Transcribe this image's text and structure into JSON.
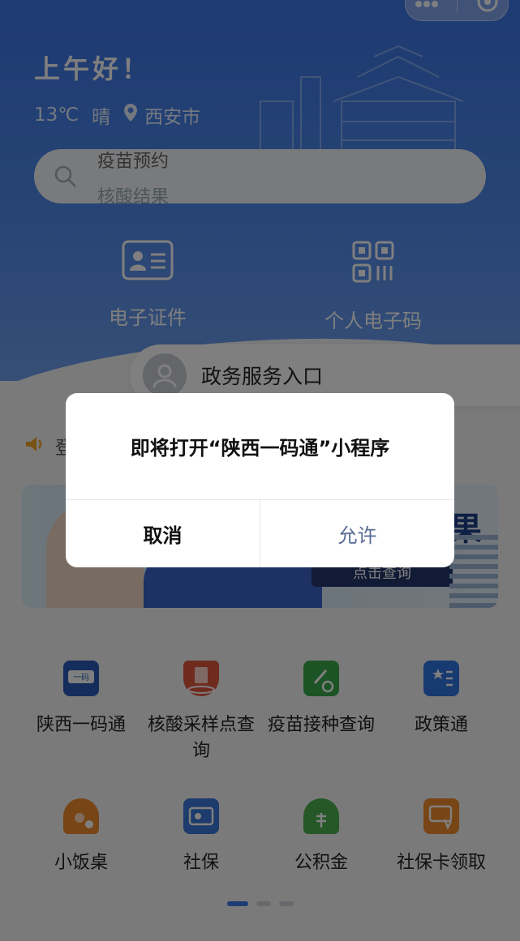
{
  "header": {
    "greeting": "上午好！",
    "temperature": "13℃",
    "weather": "晴",
    "city": "西安市",
    "search_rotating": [
      "疫苗预约",
      "核酸结果"
    ]
  },
  "quick_actions": [
    {
      "label": "电子证件",
      "icon": "id-card-icon"
    },
    {
      "label": "个人电子码",
      "icon": "qr-code-icon"
    }
  ],
  "gov_entry": {
    "label": "政务服务入口"
  },
  "notice": {
    "text": "登"
  },
  "banner": {
    "headline": "果",
    "button": "点击查询"
  },
  "services": [
    {
      "label": "陕西一码通",
      "icon": "yimatong-icon",
      "color": "#2b5bb8"
    },
    {
      "label": "核酸采样点查询",
      "icon": "sampling-point-icon",
      "color": "#e0573f"
    },
    {
      "label": "疫苗接种查询",
      "icon": "vaccine-query-icon",
      "color": "#3aa84a"
    },
    {
      "label": "政策通",
      "icon": "policy-book-icon",
      "color": "#2f74e0"
    },
    {
      "label": "小饭桌",
      "icon": "dining-house-icon",
      "color": "#f08a2c"
    },
    {
      "label": "社保",
      "icon": "social-security-icon",
      "color": "#3a76d8"
    },
    {
      "label": "公积金",
      "icon": "housing-fund-icon",
      "color": "#4bb04c"
    },
    {
      "label": "社保卡领取",
      "icon": "social-card-icon",
      "color": "#f08a2c"
    }
  ],
  "pager": {
    "pages": 3,
    "active": 1
  },
  "dialog": {
    "message": "即将打开“陕西一码通”小程序",
    "cancel": "取消",
    "allow": "允许"
  },
  "colors": {
    "brand_blue": "#3c76e6",
    "link_blue": "#576b95"
  }
}
